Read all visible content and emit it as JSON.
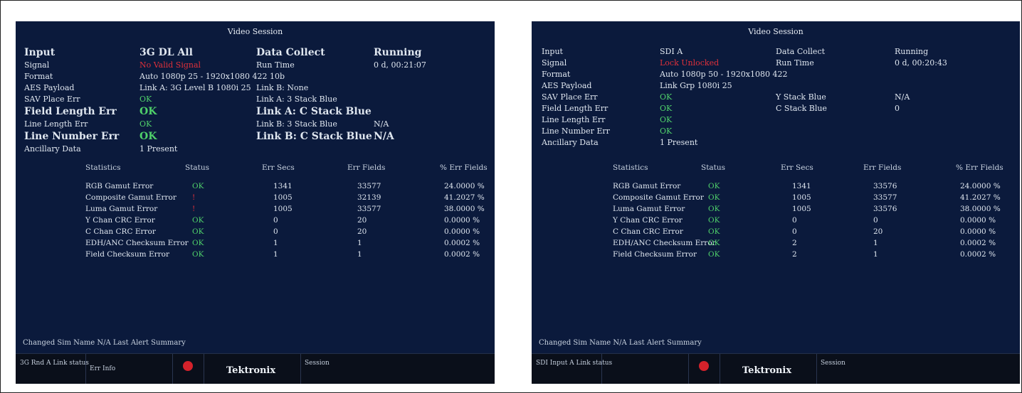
{
  "left": {
    "title": "Video Session",
    "info_rows": [
      {
        "label": "Input",
        "value": "3G DL All",
        "label2": "Data Collect",
        "value2": "Running",
        "big": true
      },
      {
        "label": "Signal",
        "value": "No Valid Signal",
        "value_red": true,
        "label2": "Run Time",
        "value2": "0 d, 00:21:07",
        "big": false
      },
      {
        "label": "Format",
        "value": "Auto 1080p 25 - 1920x1080 422 10b",
        "label2": "",
        "value2": "",
        "big": false
      },
      {
        "label": "AES Payload",
        "value": "Link A: 3G Level B 1080i 25",
        "label2": "Link B: None",
        "value2": "",
        "big": false
      },
      {
        "label": "SAV Place Err",
        "value": "OK",
        "label2": "Link A: 3 Stack Blue",
        "value2": "",
        "big": false
      },
      {
        "label": "Field Length Err",
        "value": "OK",
        "label2": "Link A: C Stack Blue",
        "value2": "",
        "big": true
      },
      {
        "label": "Line Length Err",
        "value": "OK",
        "label2": "Link B: 3 Stack Blue",
        "value2": "N/A",
        "big": false
      },
      {
        "label": "Line Number Err",
        "value": "OK",
        "label2": "Link B: C Stack Blue",
        "value2": "N/A",
        "big": true
      },
      {
        "label": "Ancillary Data",
        "value": "1 Present",
        "label2": "",
        "value2": "",
        "big": false
      }
    ],
    "stats_headers": [
      "Statistics",
      "Status",
      "Err Secs",
      "Err Fields",
      "% Err Fields"
    ],
    "stats_rows": [
      {
        "name": "RGB Gamut Error",
        "status": "OK",
        "err_secs": "1341",
        "err_fields": "33577",
        "pct": "24.0000 %"
      },
      {
        "name": "Composite Gamut Error",
        "status": "!",
        "err_secs": "1005",
        "err_fields": "32139",
        "pct": "41.2027 %"
      },
      {
        "name": "Luma Gamut Error",
        "status": "!",
        "err_secs": "1005",
        "err_fields": "33577",
        "pct": "38.0000 %"
      },
      {
        "name": "Y Chan CRC Error",
        "status": "OK",
        "err_secs": "0",
        "err_fields": "20",
        "pct": "0.0000 %"
      },
      {
        "name": "C Chan CRC Error",
        "status": "OK",
        "err_secs": "0",
        "err_fields": "20",
        "pct": "0.0000 %"
      },
      {
        "name": "EDH/ANC Checksum Error",
        "status": "OK",
        "err_secs": "1",
        "err_fields": "1",
        "pct": "0.0002 %"
      },
      {
        "name": "Field Checksum Error",
        "status": "OK",
        "err_secs": "1",
        "err_fields": "1",
        "pct": "0.0002 %"
      }
    ],
    "status_line": "Changed Sim Name  N/A    Last Alert Summary",
    "footer": {
      "cell1": "3G Rnd A  Link status",
      "cell2": "Err Info",
      "brand": "Tektronix",
      "cell4": "Session"
    }
  },
  "right": {
    "title": "Video Session",
    "info_rows": [
      {
        "label": "Input",
        "value": "SDI A",
        "label2": "Data Collect",
        "value2": "Running"
      },
      {
        "label": "Signal",
        "value": "Lock Unlocked",
        "value_red": true,
        "label2": "Run Time",
        "value2": "0 d, 00:20:43"
      },
      {
        "label": "Format",
        "value": "Auto 1080p 50 - 1920x1080 422",
        "label2": "",
        "value2": ""
      },
      {
        "label": "AES Payload",
        "value": "Link Grp 1080i 25",
        "label2": "",
        "value2": ""
      },
      {
        "label": "SAV Place Err",
        "value": "OK",
        "label2": "Y Stack Blue",
        "value2": "N/A"
      },
      {
        "label": "Field Length Err",
        "value": "OK",
        "label2": "C Stack Blue",
        "value2": "0"
      },
      {
        "label": "Line Length Err",
        "value": "OK",
        "label2": "",
        "value2": ""
      },
      {
        "label": "Line Number Err",
        "value": "OK",
        "label2": "",
        "value2": ""
      },
      {
        "label": "Ancillary Data",
        "value": "1 Present",
        "label2": "",
        "value2": ""
      }
    ],
    "stats_headers": [
      "Statistics",
      "Status",
      "Err Secs",
      "Err Fields",
      "% Err Fields"
    ],
    "stats_rows": [
      {
        "name": "RGB Gamut Error",
        "status": "OK",
        "err_secs": "1341",
        "err_fields": "33576",
        "pct": "24.0000 %"
      },
      {
        "name": "Composite Gamut Error",
        "status": "OK",
        "err_secs": "1005",
        "err_fields": "33577",
        "pct": "41.2027 %"
      },
      {
        "name": "Luma Gamut Error",
        "status": "OK",
        "err_secs": "1005",
        "err_fields": "33576",
        "pct": "38.0000 %"
      },
      {
        "name": "Y Chan CRC Error",
        "status": "OK",
        "err_secs": "0",
        "err_fields": "0",
        "pct": "0.0000 %"
      },
      {
        "name": "C Chan CRC Error",
        "status": "OK",
        "err_secs": "0",
        "err_fields": "20",
        "pct": "0.0000 %"
      },
      {
        "name": "EDH/ANC Checksum Error",
        "status": "OK",
        "err_secs": "2",
        "err_fields": "1",
        "pct": "0.0002 %"
      },
      {
        "name": "Field Checksum Error",
        "status": "OK",
        "err_secs": "2",
        "err_fields": "1",
        "pct": "0.0002 %"
      }
    ],
    "status_line": "Changed Sim Name  N/A    Last Alert Summary",
    "footer": {
      "cell1": "SDI Input A  Link status",
      "brand": "Tektronix",
      "cell4": "Session"
    }
  }
}
